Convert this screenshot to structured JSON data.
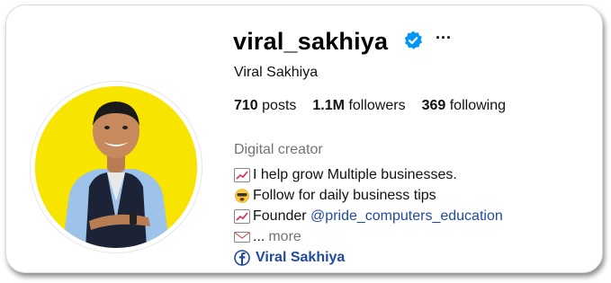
{
  "profile": {
    "username": "viral_sakhiya",
    "full_name": "Viral Sakhiya",
    "stats": {
      "posts_count": "710",
      "posts_label": "posts",
      "followers_count": "1.1M",
      "followers_label": "followers",
      "following_count": "369",
      "following_label": "following"
    },
    "category": "Digital creator",
    "bio": {
      "line1": "I help grow Multiple businesses.",
      "line2": "Follow for daily business tips",
      "line3_prefix": "Founder",
      "line3_mention": "@pride_computers_education",
      "line4_ellipsis": "...",
      "more_label": "more"
    },
    "link": {
      "label": "Viral Sakhiya",
      "icon": "facebook-icon"
    },
    "more_options_glyph": "···"
  },
  "colors": {
    "verified": "#0095f6",
    "link": "#1f4aa0",
    "muted": "#737373",
    "avatar_bg": "#f7e400"
  },
  "icons": [
    "verified-badge-icon",
    "more-options-icon",
    "chart-increasing-emoji-icon",
    "face-emoji-icon",
    "envelope-emoji-icon",
    "facebook-icon"
  ]
}
